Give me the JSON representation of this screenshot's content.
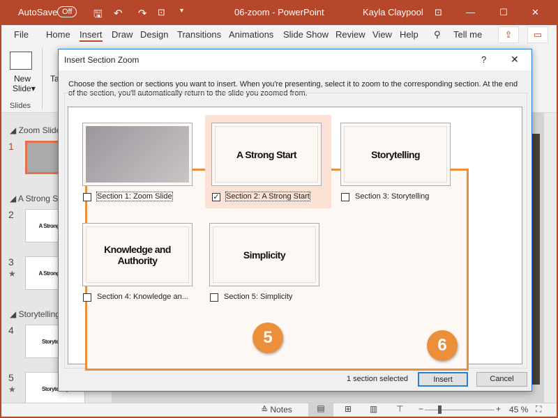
{
  "titlebar": {
    "autosave_label": "AutoSave",
    "autosave_state": "Off",
    "doc_title": "06-zoom  -  PowerPoint",
    "user": "Kayla Claypool"
  },
  "ribbon_tabs": [
    "File",
    "Home",
    "Insert",
    "Draw",
    "Design",
    "Transitions",
    "Animations",
    "Slide Show",
    "Review",
    "View",
    "Help"
  ],
  "active_tab": "Insert",
  "tell_me": "Tell me",
  "ribbon": {
    "new_slide": "New",
    "new_slide2": "Slide",
    "group_slides": "Slides",
    "table_partial": "Ta"
  },
  "slide_pane": {
    "sections": [
      {
        "name": "Zoom Slide",
        "slides": [
          {
            "num": "1",
            "title": ""
          }
        ]
      },
      {
        "name": "A Strong Start",
        "slides": [
          {
            "num": "2",
            "title": "A Strong Start"
          },
          {
            "num": "3",
            "title": "A Strong Start",
            "star": "★"
          }
        ]
      },
      {
        "name": "Storytelling",
        "slides": [
          {
            "num": "4",
            "title": "Storytelling"
          },
          {
            "num": "5",
            "title": "Storytelling",
            "star": "★"
          }
        ]
      }
    ]
  },
  "dialog": {
    "title": "Insert Section Zoom",
    "help": "?",
    "close": "✕",
    "instructions": "Choose the section or sections you want to insert. When you're presenting, select it to zoom to the corresponding section. At the end of the section, you'll automatically return to the slide you zoomed from.",
    "items": [
      {
        "thumb": "",
        "label": "Section 1: Zoom Slide",
        "checked": false
      },
      {
        "thumb": "A Strong Start",
        "label": "Section 2: A Strong Start",
        "checked": true
      },
      {
        "thumb": "Storytelling",
        "label": "Section 3: Storytelling",
        "checked": false
      },
      {
        "thumb": "Knowledge and Authority",
        "label": "Section 4: Knowledge an...",
        "checked": false
      },
      {
        "thumb": "Simplicity",
        "label": "Section 5: Simplicity",
        "checked": false
      }
    ],
    "status": "1 section selected",
    "insert": "Insert",
    "cancel": "Cancel"
  },
  "callouts": {
    "five": "5",
    "six": "6"
  },
  "statusbar": {
    "notes": "Notes",
    "zoom": "45 %",
    "zoom_percent": 45
  },
  "colors": {
    "accent": "#b7472a",
    "callout": "#ec8f3b",
    "selection": "#fbe2d5",
    "focus_blue": "#2b7cd3"
  }
}
